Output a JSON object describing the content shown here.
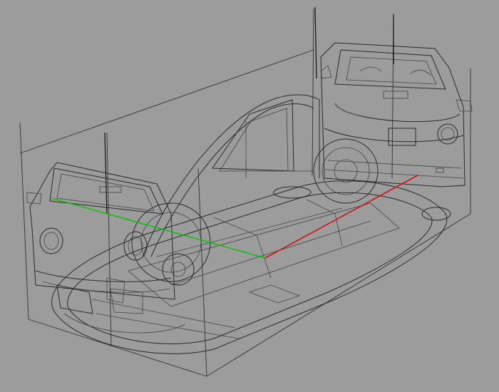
{
  "viewport": {
    "background": "#9c9c9c",
    "line_color": "#2a2a2a",
    "axes": {
      "x_axis_color": "#d01010",
      "y_axis_color": "#10c010"
    }
  },
  "reference_images": [
    {
      "name": "front-view"
    },
    {
      "name": "rear-view"
    },
    {
      "name": "side-view"
    },
    {
      "name": "top-view"
    }
  ]
}
